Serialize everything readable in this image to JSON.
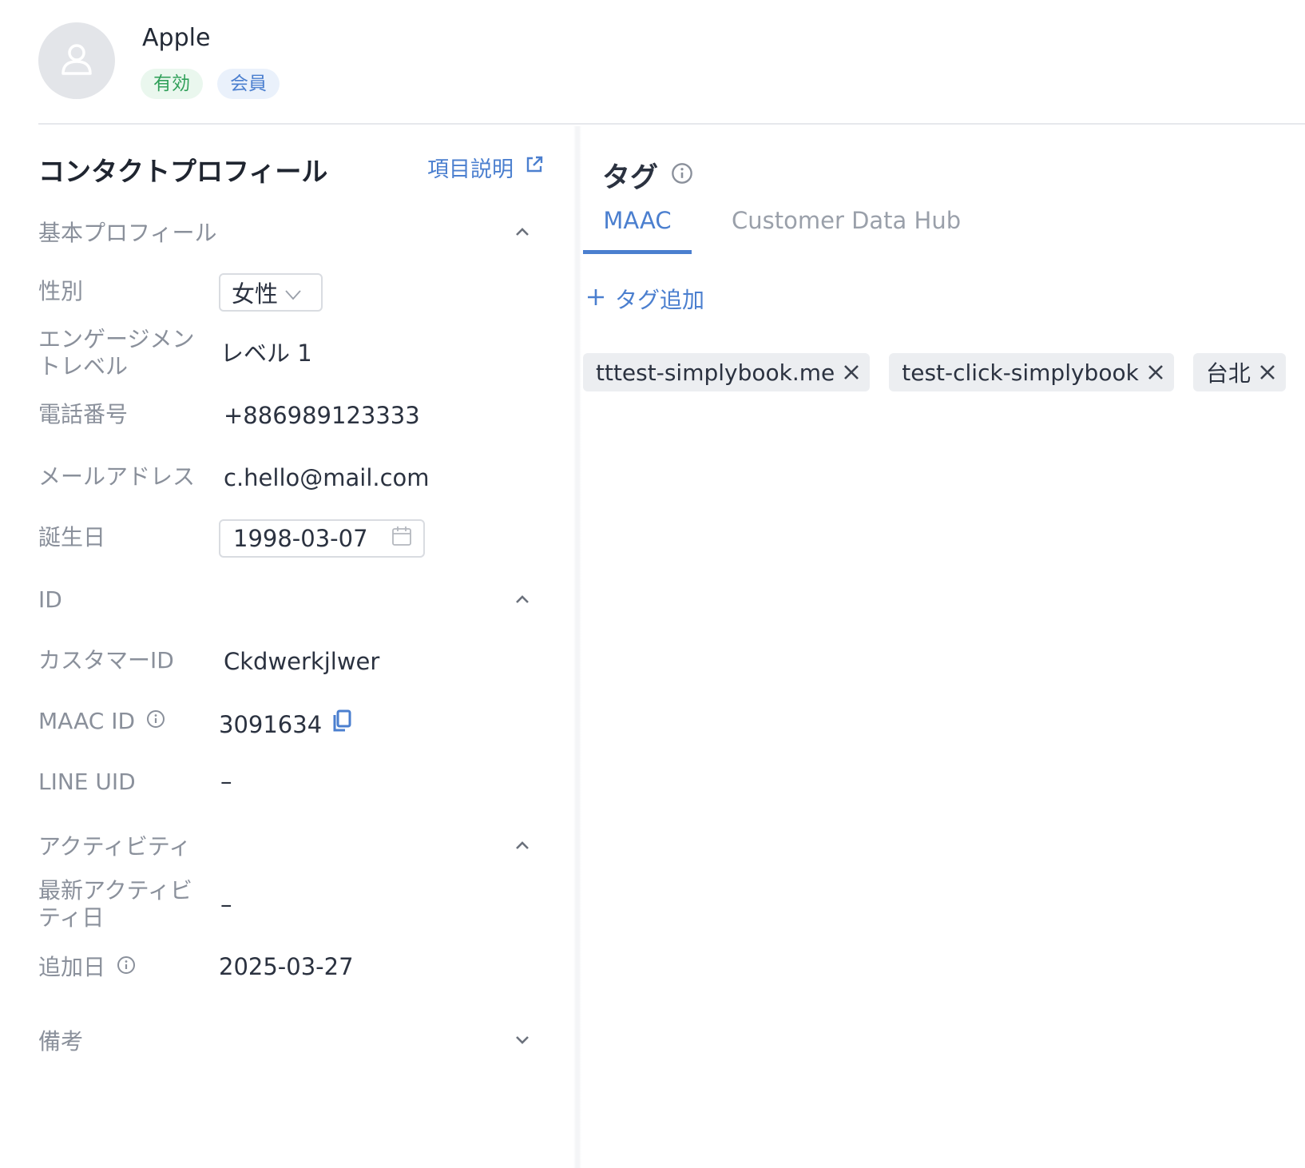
{
  "contact": {
    "name": "Apple",
    "badges": {
      "active": "有効",
      "member": "会員"
    }
  },
  "profile": {
    "title": "コンタクトプロフィール",
    "help_link": "項目説明",
    "sections": {
      "basic": "基本プロフィール",
      "id": "ID",
      "activity": "アクティビティ",
      "notes": "備考"
    },
    "fields": {
      "gender_label": "性別",
      "gender_value": "女性",
      "engagement_label_line1": "エンゲージメン",
      "engagement_label_line2": "トレベル",
      "engagement_value": "レベル 1",
      "phone_label": "電話番号",
      "phone_value": "+886989123333",
      "email_label": "メールアドレス",
      "email_value": "c.hello@mail.com",
      "birthday_label": "誕生日",
      "birthday_value": "1998-03-07",
      "customer_id_label": "カスタマーID",
      "customer_id_value": "Ckdwerkjlwer",
      "maac_id_label": "MAAC ID",
      "maac_id_value": "3091634",
      "line_uid_label": "LINE UID",
      "line_uid_value": "–",
      "last_activity_label_line1": "最新アクティビ",
      "last_activity_label_line2": "ティ日",
      "last_activity_value": "–",
      "added_label": "追加日",
      "added_value": "2025-03-27"
    }
  },
  "tags": {
    "title": "タグ",
    "tabs": [
      "MAAC",
      "Customer Data Hub"
    ],
    "add_label": "タグ追加",
    "items": [
      "tttest-simplybook.me",
      "test-click-simplybook",
      "台北"
    ]
  },
  "colors": {
    "accent": "#4b7fcf",
    "active_badge_bg": "#eaf7ee",
    "active_badge_text": "#31a05a",
    "member_badge_bg": "#eaf1fb",
    "label_gray": "#8a909b",
    "chip_bg": "#eceef1"
  },
  "icons": {
    "avatar": "user-icon",
    "help_link": "external-link-icon",
    "info": "info-icon",
    "copy": "copy-icon",
    "calendar": "calendar-icon",
    "collapse": "chevron-up-icon",
    "expand": "chevron-down-icon",
    "add": "plus-icon",
    "remove": "close-icon"
  }
}
